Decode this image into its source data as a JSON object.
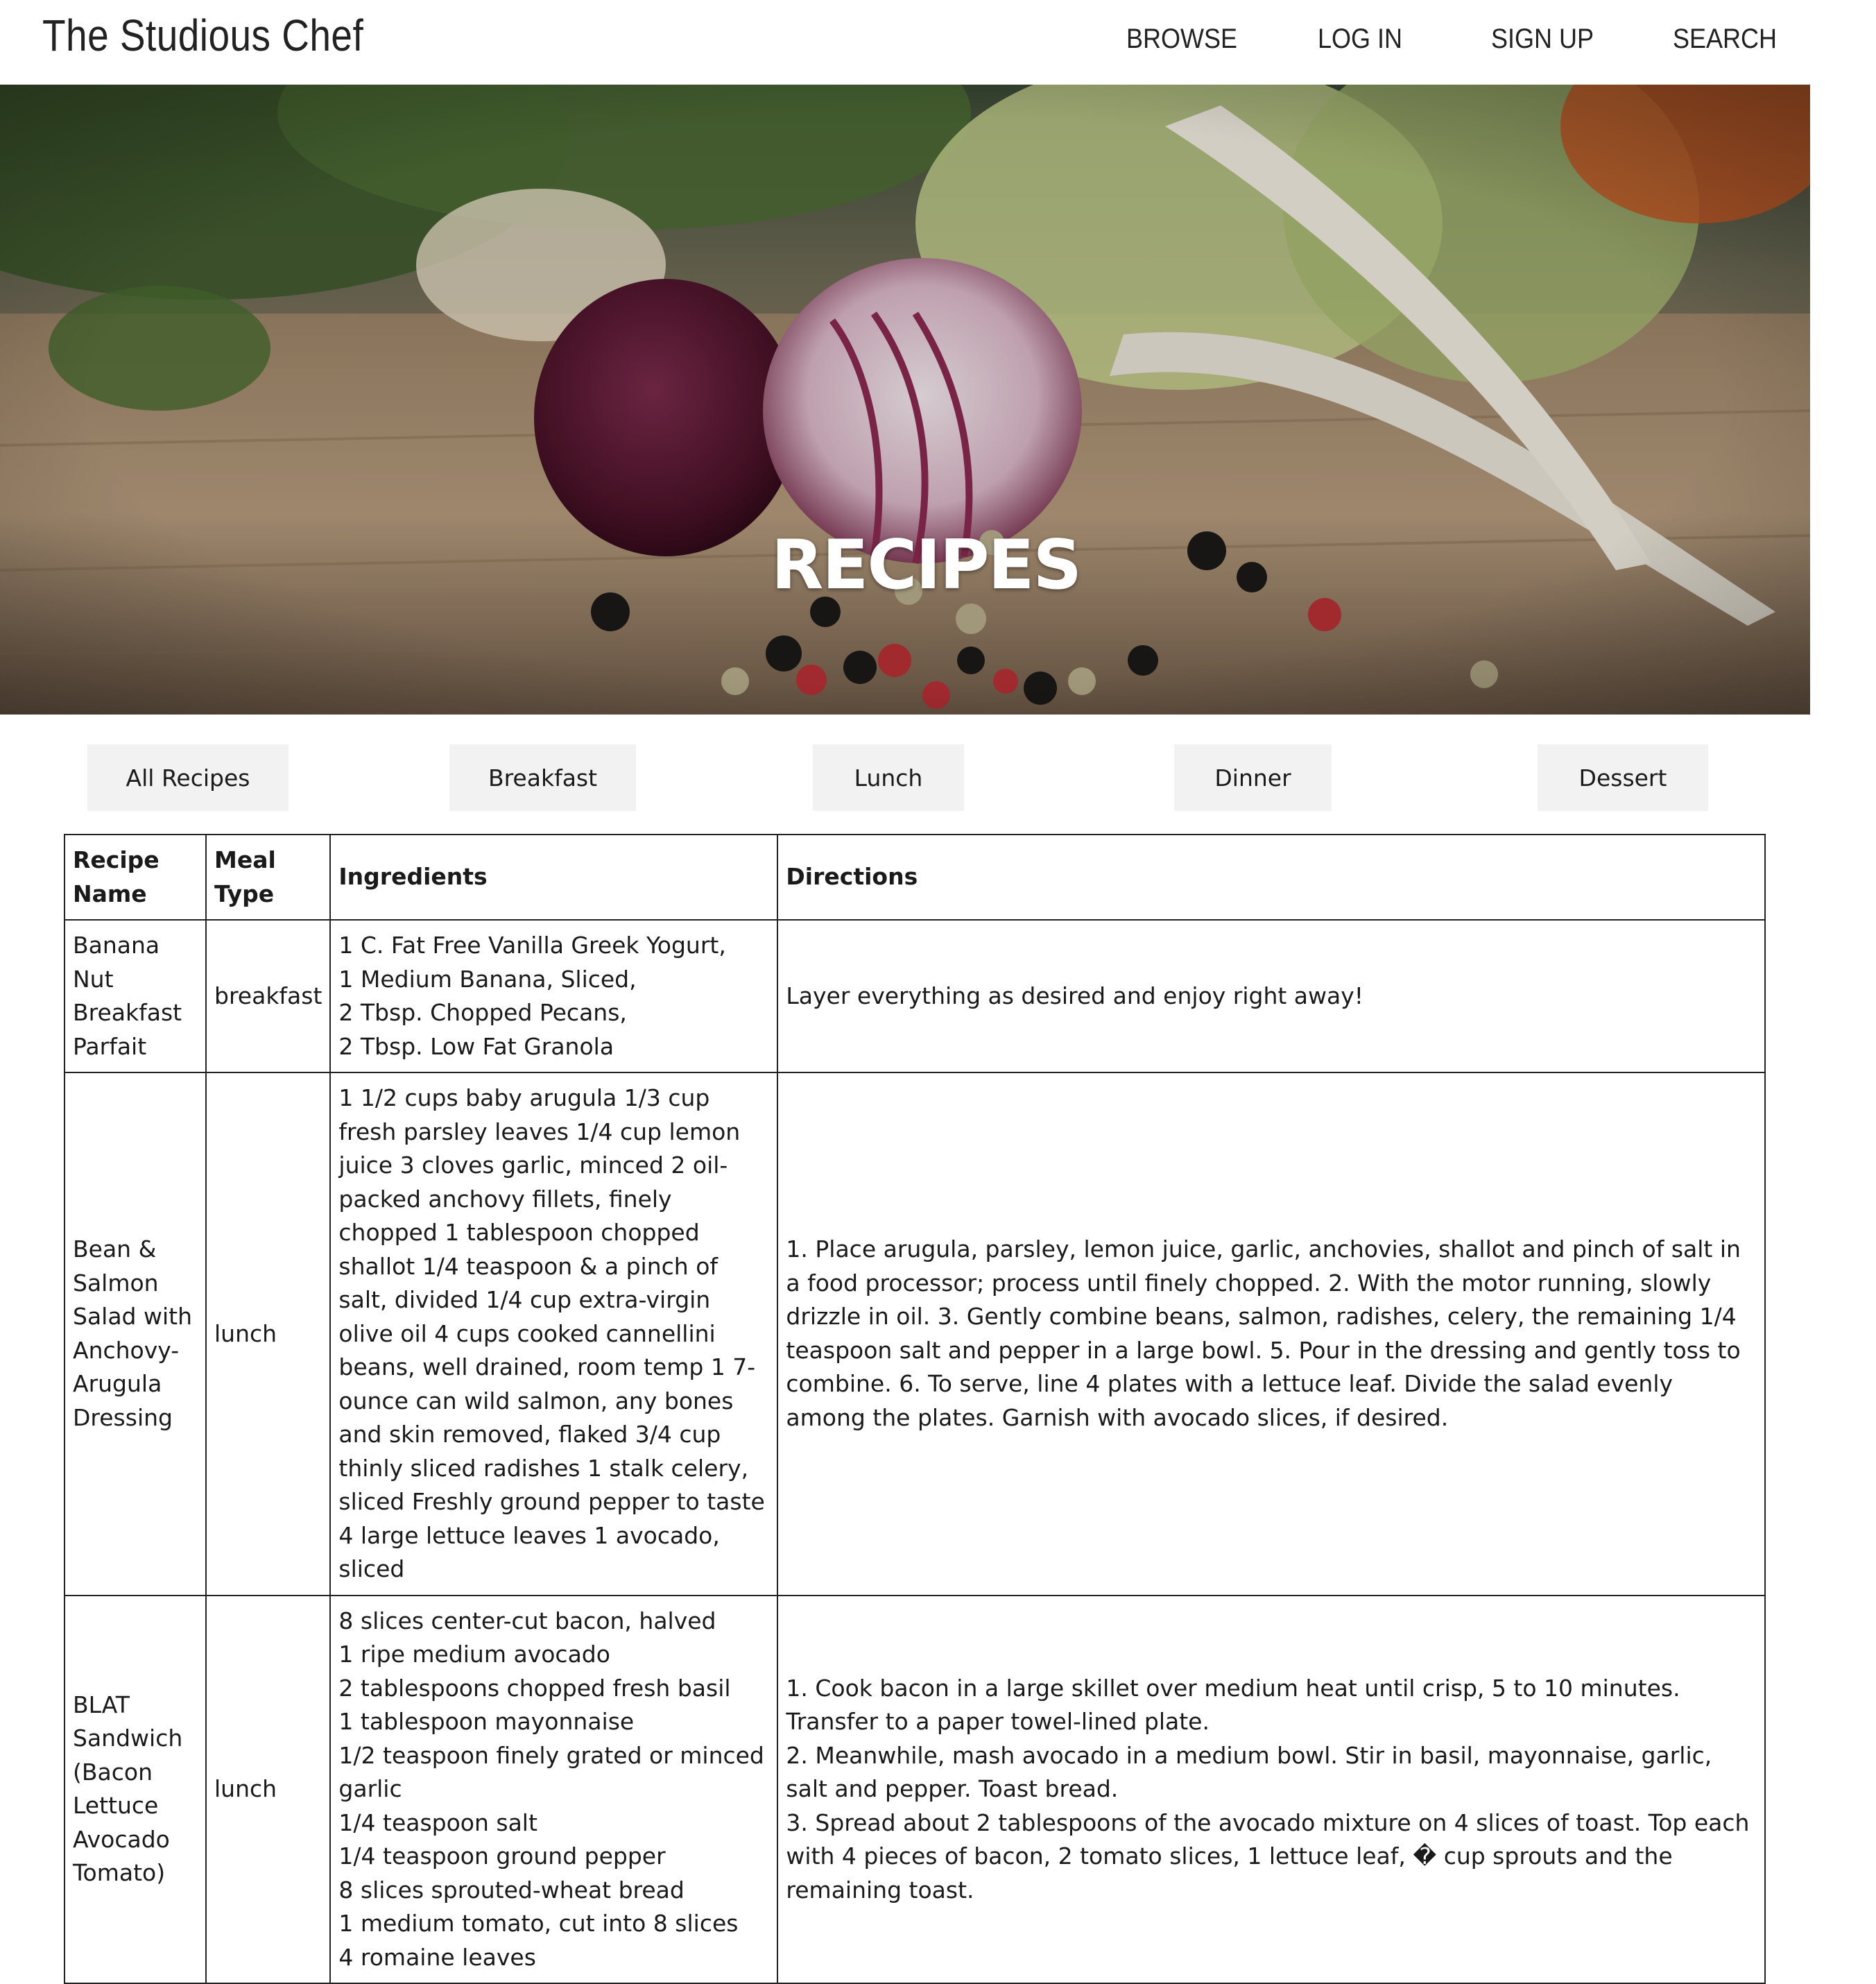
{
  "header": {
    "brand": "The Studious Chef",
    "nav": [
      "BROWSE",
      "LOG IN",
      "SIGN UP",
      "SEARCH"
    ]
  },
  "hero": {
    "title": "RECIPES"
  },
  "filters": [
    "All Recipes",
    "Breakfast",
    "Lunch",
    "Dinner",
    "Dessert"
  ],
  "table": {
    "headers": [
      "Recipe Name",
      "Meal Type",
      "Ingredients",
      "Directions"
    ],
    "rows": [
      {
        "name": "Banana Nut Breakfast Parfait",
        "meal": "breakfast",
        "ingredients": [
          "1 C. Fat Free Vanilla Greek Yogurt,",
          "1 Medium Banana, Sliced,",
          "2 Tbsp. Chopped Pecans,",
          "2 Tbsp. Low Fat Granola"
        ],
        "directions": [
          "Layer everything as desired and enjoy right away!"
        ]
      },
      {
        "name": "Bean & Salmon Salad with Anchovy-Arugula Dressing",
        "meal": "lunch",
        "ingredients": [
          "1 1/2 cups baby arugula 1/3 cup fresh parsley leaves 1/4 cup lemon juice 3 cloves garlic, minced 2 oil-packed anchovy fillets, finely chopped 1 tablespoon chopped shallot 1/4 teaspoon & a pinch of salt, divided 1/4 cup extra-virgin olive oil 4 cups cooked cannellini beans, well drained, room temp 1 7-ounce can wild salmon, any bones and skin removed, flaked 3/4 cup thinly sliced radishes 1 stalk celery, sliced Freshly ground pepper to taste 4 large lettuce leaves 1 avocado, sliced"
        ],
        "directions": [
          "1. Place arugula, parsley, lemon juice, garlic, anchovies, shallot and pinch of salt in a food processor; process until finely chopped. 2. With the motor running, slowly drizzle in oil. 3. Gently combine beans, salmon, radishes, celery, the remaining 1/4 teaspoon salt and pepper in a large bowl. 5. Pour in the dressing and gently toss to combine. 6. To serve, line 4 plates with a lettuce leaf. Divide the salad evenly among the plates. Garnish with avocado slices, if desired."
        ]
      },
      {
        "name": "BLAT Sandwich (Bacon Lettuce Avocado Tomato)",
        "meal": "lunch",
        "ingredients": [
          "8 slices center-cut bacon, halved",
          "1 ripe medium avocado",
          "2 tablespoons chopped fresh basil",
          "1 tablespoon mayonnaise",
          "1/2 teaspoon finely grated or minced garlic",
          "1/4 teaspoon salt",
          "1/4 teaspoon ground pepper",
          "8 slices sprouted-wheat bread",
          "1 medium tomato, cut into 8 slices",
          "4 romaine leaves"
        ],
        "directions": [
          "1. Cook bacon in a large skillet over medium heat until crisp, 5 to 10 minutes. Transfer to a paper towel-lined plate.",
          "2. Meanwhile, mash avocado in a medium bowl. Stir in basil, mayonnaise, garlic, salt and pepper. Toast bread.",
          "3. Spread about 2 tablespoons of the avocado mixture on 4 slices of toast. Top each with 4 pieces of bacon, 2 tomato slices, 1 lettuce leaf, � cup sprouts and the remaining toast."
        ]
      }
    ]
  }
}
